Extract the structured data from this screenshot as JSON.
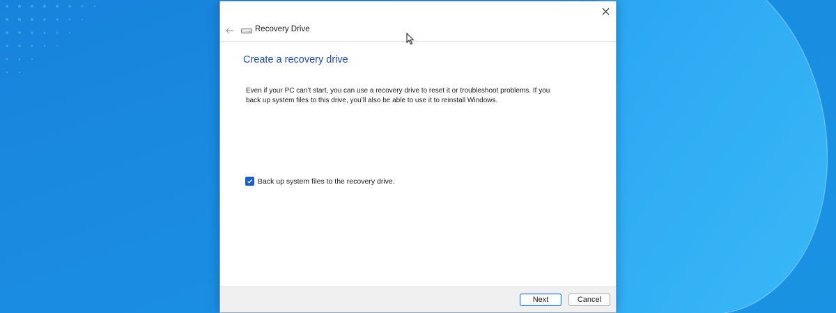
{
  "window": {
    "close_icon": "close-icon",
    "back_icon": "back-arrow-icon",
    "drive_icon": "drive-icon",
    "nav_title": "Recovery Drive"
  },
  "content": {
    "heading": "Create a recovery drive",
    "description": "Even if your PC can’t start, you can use a recovery drive to reset it or troubleshoot problems. If you back up system files to this drive, you’ll also be able to use it to reinstall Windows.",
    "checkbox": {
      "label": "Back up system files to the recovery drive.",
      "checked": true
    }
  },
  "footer": {
    "next_label": "Next",
    "cancel_label": "Cancel"
  },
  "colors": {
    "desktop_blue": "#1a8fe0",
    "heading_blue": "#1f4aa8",
    "checkbox_blue": "#1c5fc4"
  }
}
